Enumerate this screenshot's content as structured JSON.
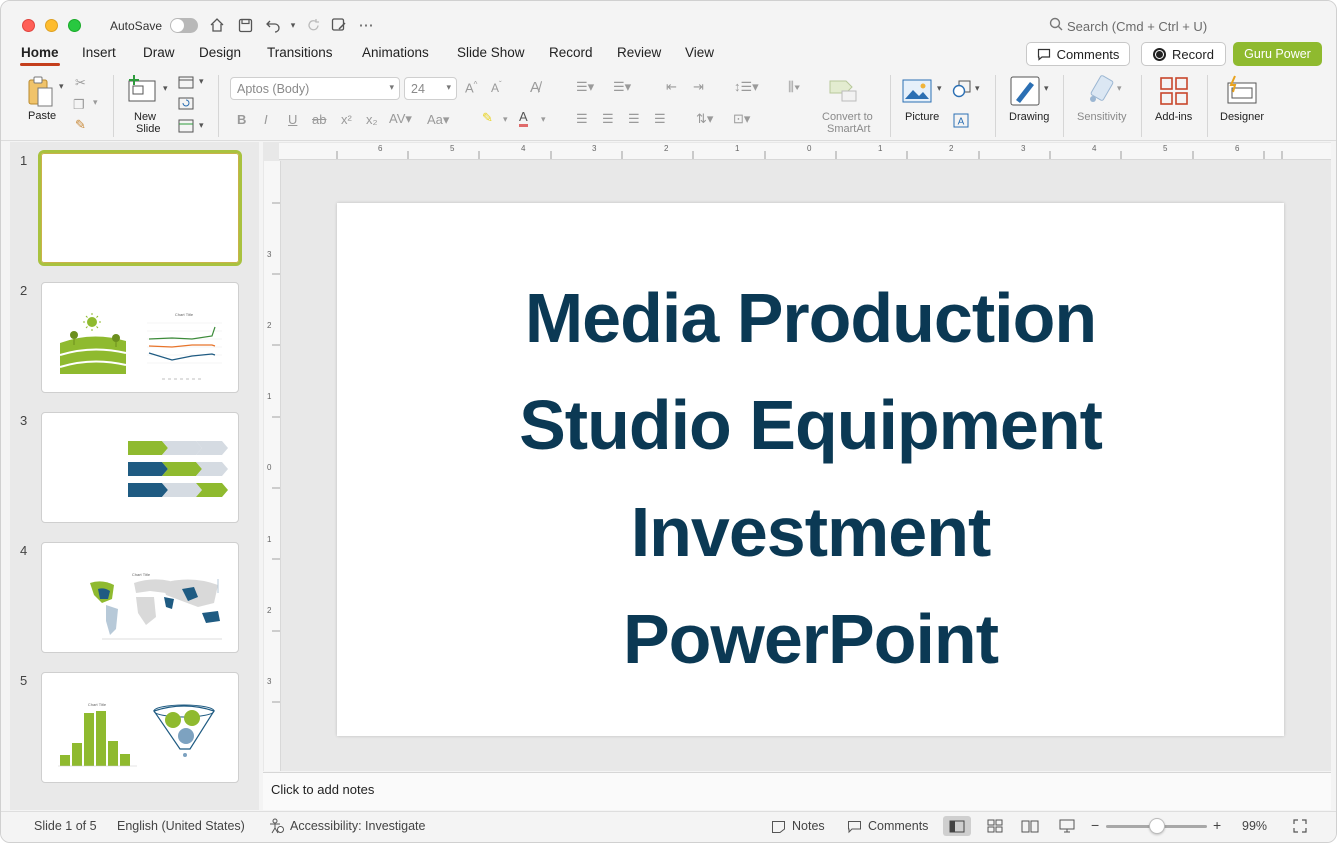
{
  "titlebar": {
    "autosave_label": "AutoSave",
    "search_placeholder": "Search (Cmd + Ctrl + U)"
  },
  "tabs": [
    {
      "label": "Home",
      "active": true
    },
    {
      "label": "Insert"
    },
    {
      "label": "Draw"
    },
    {
      "label": "Design"
    },
    {
      "label": "Transitions"
    },
    {
      "label": "Animations"
    },
    {
      "label": "Slide Show"
    },
    {
      "label": "Record"
    },
    {
      "label": "Review"
    },
    {
      "label": "View"
    }
  ],
  "actions": {
    "comments": "Comments",
    "record": "Record",
    "guru": "Guru Power"
  },
  "ribbon": {
    "paste": "Paste",
    "new_slide_line1": "New",
    "new_slide_line2": "Slide",
    "font_name": "Aptos (Body)",
    "font_size": "24",
    "smartart_line1": "Convert to",
    "smartart_line2": "SmartArt",
    "picture": "Picture",
    "drawing": "Drawing",
    "sensitivity": "Sensitivity",
    "addins": "Add-ins",
    "designer": "Designer"
  },
  "thumbnails": [
    {
      "num": "1"
    },
    {
      "num": "2",
      "chart_title": "Chart Title"
    },
    {
      "num": "3"
    },
    {
      "num": "4",
      "chart_title": "Chart Title"
    },
    {
      "num": "5",
      "chart_title": "Chart Title"
    }
  ],
  "ruler_h": [
    "6",
    "5",
    "4",
    "3",
    "2",
    "1",
    "0",
    "1",
    "2",
    "3",
    "4",
    "5",
    "6"
  ],
  "ruler_v": [
    "3",
    "2",
    "1",
    "0",
    "1",
    "2",
    "3"
  ],
  "slide": {
    "title_lines": [
      "Media Production",
      "Studio Equipment",
      "Investment",
      "PowerPoint"
    ]
  },
  "notes_placeholder": "Click to add notes",
  "status": {
    "slide_counter": "Slide 1 of 5",
    "language": "English (United States)",
    "accessibility": "Accessibility: Investigate",
    "notes": "Notes",
    "comments": "Comments",
    "zoom": "99%"
  },
  "colors": {
    "accent_green": "#8fba2f",
    "title_navy": "#0b3954",
    "tab_underline": "#c43e1c",
    "thumb_blue": "#1f5b82"
  }
}
